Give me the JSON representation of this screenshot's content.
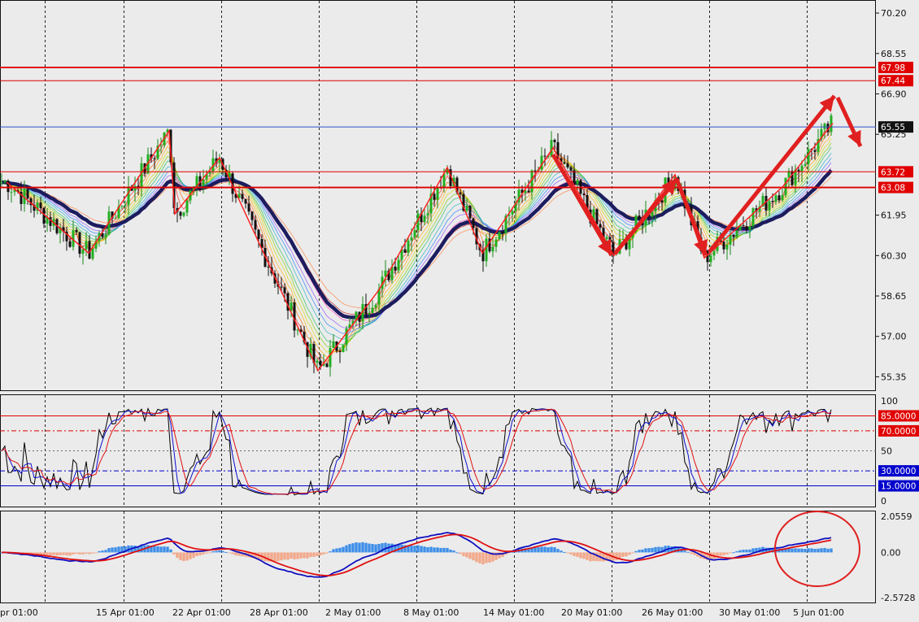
{
  "chart_data": [
    {
      "type": "candlestick",
      "panel": "price",
      "y_ticks": [
        "70.20",
        "68.55",
        "66.90",
        "65.25",
        "61.95",
        "60.30",
        "58.65",
        "57.00",
        "55.35"
      ],
      "ylim": [
        54.8,
        70.7
      ],
      "current_price": {
        "label": "65.55",
        "value": 65.55
      },
      "horizontal_levels": [
        {
          "label": "67.98",
          "value": 67.98,
          "color": "#e00000"
        },
        {
          "label": "67.44",
          "value": 67.44,
          "color": "#e00000"
        },
        {
          "label": "63.72",
          "value": 63.72,
          "color": "#e00000"
        },
        {
          "label": "63.08",
          "value": 63.08,
          "color": "#e00000"
        }
      ],
      "zigzag": [
        [
          "Apr 10",
          63.3
        ],
        [
          "Apr 15",
          60.4
        ],
        [
          "Apr 19",
          65.4
        ],
        [
          "Apr 21",
          62.0
        ],
        [
          "Apr 24",
          64.3
        ],
        [
          "May 2",
          55.6
        ],
        [
          "May 8",
          58.9
        ],
        [
          "May 11",
          63.9
        ],
        [
          "May 14",
          60.4
        ],
        [
          "May 19",
          64.7
        ],
        [
          "May 24",
          60.3
        ],
        [
          "May 28",
          63.6
        ],
        [
          "May 30",
          60.2
        ],
        [
          "Jun 5",
          63.1
        ],
        [
          "Jun 9",
          65.7
        ]
      ],
      "candles_summary": "daily-intraday candles from ~10 Apr to ~9 Jun",
      "moving_averages": "ribbon of colored EMAs plus thick navy EMA"
    },
    {
      "type": "line",
      "panel": "stochastic",
      "y_ticks": [
        "100",
        "85.0000",
        "70.0000",
        "50",
        "30.0000",
        "15.0000",
        "0"
      ],
      "ylim": [
        0,
        100
      ],
      "levels": [
        {
          "label": "85.0000",
          "value": 85,
          "color": "#e00000"
        },
        {
          "label": "70.0000",
          "value": 70,
          "color": "#e00000"
        },
        {
          "label": "30.0000",
          "value": 30,
          "color": "#0000cc"
        },
        {
          "label": "15.0000",
          "value": 15,
          "color": "#0000cc"
        }
      ]
    },
    {
      "type": "histogram",
      "panel": "macd",
      "y_ticks": [
        "2.0559",
        "0.00",
        "-2.5728"
      ],
      "ylim": [
        -2.5728,
        2.0559
      ]
    }
  ],
  "x_ticks": [
    "pr 01:00",
    "15 Apr 01:00",
    "22 Apr 01:00",
    "28 Apr 01:00",
    "2 May 01:00",
    "8 May 01:00",
    "14 May 01:00",
    "20 May 01:00",
    "26 May 01:00",
    "30 May 01:00",
    "5 Jun 01:00"
  ],
  "colors": {
    "background": "#ebebeb",
    "level_red": "#e00000",
    "level_blue": "#0000cc",
    "ema_thick": "#1c1c5e",
    "macd_hist_pos": "#3d8ee8",
    "macd_hist_neg": "#f2a88a",
    "annotation_red": "#e02020"
  }
}
